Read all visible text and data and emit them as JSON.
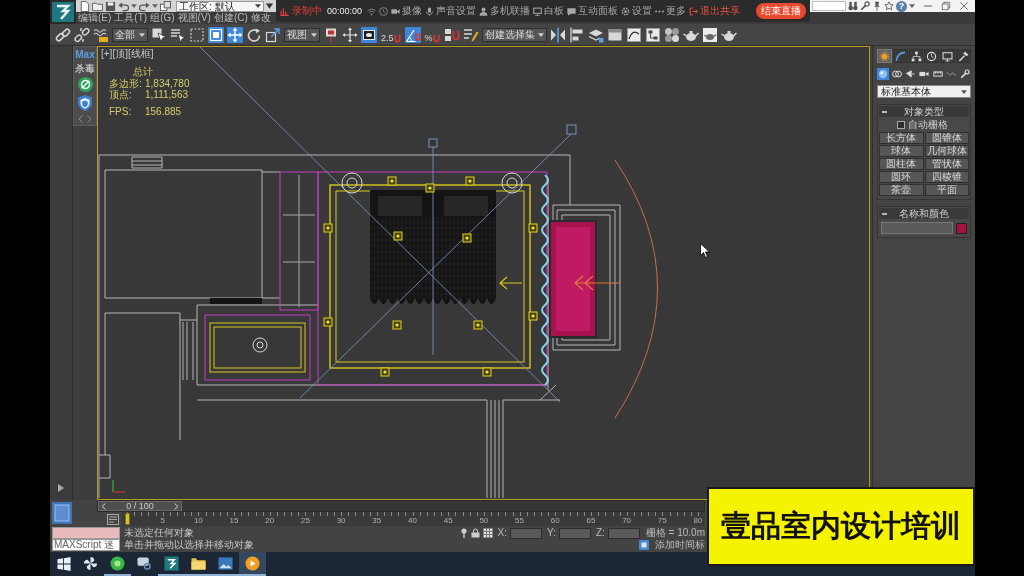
{
  "title_bar": {
    "workspace": "工作区: 默认",
    "help": "?"
  },
  "menus": [
    "编辑(E)",
    "工具(T)",
    "组(G)",
    "视图(V)",
    "创建(C)",
    "修改"
  ],
  "recording_bar": {
    "status": "录制中",
    "timer": "00:00:00",
    "actions": [
      {
        "kind": "normal",
        "label": "摄像"
      },
      {
        "kind": "normal",
        "label": "声音设置"
      },
      {
        "kind": "normal",
        "label": "多机联播"
      },
      {
        "kind": "normal",
        "label": "白板"
      },
      {
        "kind": "normal",
        "label": "互动面板"
      },
      {
        "kind": "normal",
        "label": "设置"
      },
      {
        "kind": "normal",
        "label": "更多"
      },
      {
        "kind": "exit",
        "label": "退出共享"
      }
    ],
    "end_button": "结束直播"
  },
  "toolbar": {
    "items": [
      {
        "kind": "tool",
        "active": false
      },
      {
        "kind": "tool",
        "active": false
      },
      {
        "kind": "tool",
        "active": false
      },
      {
        "kind": "dropdown",
        "value": "全部"
      },
      {
        "kind": "tool",
        "active": false
      },
      {
        "kind": "tool",
        "active": false
      },
      {
        "kind": "tool",
        "active": false
      },
      {
        "kind": "tool",
        "active": true
      },
      {
        "kind": "tool",
        "active": true
      },
      {
        "kind": "tool",
        "active": false
      },
      {
        "kind": "tool",
        "active": false
      },
      {
        "kind": "dropdown",
        "value": "视图"
      },
      {
        "kind": "tool",
        "active": false
      },
      {
        "kind": "tool",
        "active": false
      },
      {
        "kind": "tool",
        "active": true
      },
      {
        "kind": "snap",
        "label": "2.5",
        "active": false
      },
      {
        "kind": "tool",
        "active": true
      },
      {
        "kind": "snap",
        "label": "%",
        "active": false
      },
      {
        "kind": "tool",
        "active": false
      },
      {
        "kind": "tool",
        "active": false
      },
      {
        "kind": "dropdown",
        "value": "创建选择集"
      },
      {
        "kind": "tool",
        "active": false
      },
      {
        "kind": "tool",
        "active": false
      },
      {
        "kind": "tool",
        "active": false
      },
      {
        "kind": "tool",
        "active": false
      },
      {
        "kind": "tool",
        "active": false
      },
      {
        "kind": "tool",
        "active": false
      },
      {
        "kind": "tool",
        "active": false
      },
      {
        "kind": "tool",
        "active": false
      },
      {
        "kind": "tool",
        "active": false
      },
      {
        "kind": "tool",
        "active": false
      }
    ]
  },
  "plugin": {
    "title": "Max",
    "subtitle": "杀毒"
  },
  "viewport": {
    "active": true,
    "label": "[+][顶][线框]",
    "stats_title": "总计",
    "stats": [
      {
        "label": "多边形:",
        "value": "1,834,780"
      },
      {
        "label": "顶点:",
        "value": "1,111,563"
      }
    ],
    "fps": {
      "label": "FPS:",
      "value": "156.885"
    }
  },
  "command_panel": {
    "tabs": [
      {
        "selected": true
      },
      {
        "selected": false
      },
      {
        "selected": false
      },
      {
        "selected": false
      },
      {
        "selected": false
      },
      {
        "selected": false
      }
    ],
    "categories": [
      {
        "selected": true
      },
      {
        "selected": false
      },
      {
        "selected": false
      },
      {
        "selected": false
      },
      {
        "selected": false
      },
      {
        "selected": false
      },
      {
        "selected": false
      }
    ],
    "type_dropdown": "标准基本体",
    "object_type": {
      "title": "对象类型",
      "auto_grid": {
        "label": "自动栅格",
        "checked": false
      },
      "buttons": [
        "长方体",
        "圆锥体",
        "球体",
        "几何球体",
        "圆柱体",
        "管状体",
        "圆环",
        "四棱锥",
        "茶壶",
        "平面"
      ]
    },
    "name_color": {
      "title": "名称和颜色",
      "color": "#a8123e"
    }
  },
  "time_slider": {
    "position": "0 / 100",
    "level": 0
  },
  "track_bar": {
    "labels": [
      "5",
      "10",
      "15",
      "20",
      "25",
      "30",
      "35",
      "40",
      "45",
      "50",
      "55",
      "60",
      "65",
      "70",
      "75",
      "80"
    ]
  },
  "status_bar": {
    "listener_text": "MAXScript 迷",
    "prompt": "未选定任何对象",
    "hint": "单击并拖动以选择并移动对象",
    "coords": [
      {
        "label": "X:"
      },
      {
        "label": "Y:"
      },
      {
        "label": "Z:"
      }
    ],
    "grid": "栅格 = 10.0m",
    "time_tag": "添加时间标"
  },
  "taskbar": {
    "apps": [
      {
        "running": false,
        "selected": false
      },
      {
        "running": true,
        "selected": false
      },
      {
        "running": false,
        "selected": false
      },
      {
        "running": true,
        "selected": false
      },
      {
        "running": true,
        "selected": false
      },
      {
        "running": true,
        "selected": false
      },
      {
        "running": true,
        "selected": true
      }
    ]
  },
  "banner": {
    "text": "壹品室内设计培训"
  }
}
